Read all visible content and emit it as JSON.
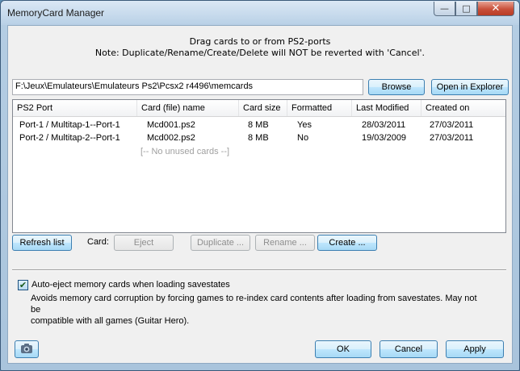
{
  "window": {
    "title": "MemoryCard Manager"
  },
  "notes": {
    "line1": "Drag cards to or from PS2-ports",
    "line2": "Note: Duplicate/Rename/Create/Delete will NOT be reverted with 'Cancel'."
  },
  "path": {
    "value": "F:\\Jeux\\Emulateurs\\Emulateurs Ps2\\Pcsx2 r4496\\memcards",
    "browse_label": "Browse",
    "open_explorer_label": "Open in Explorer"
  },
  "table": {
    "columns": [
      "PS2 Port",
      "Card (file) name",
      "Card size",
      "Formatted",
      "Last Modified",
      "Created on"
    ],
    "rows": [
      {
        "port": "Port-1 / Multitap-1--Port-1",
        "name": "Mcd001.ps2",
        "size": "8 MB",
        "formatted": "Yes",
        "modified": "28/03/2011",
        "created": "27/03/2011"
      },
      {
        "port": "Port-2 / Multitap-2--Port-1",
        "name": "Mcd002.ps2",
        "size": "8 MB",
        "formatted": "No",
        "modified": "19/03/2009",
        "created": "27/03/2011"
      }
    ],
    "unused_placeholder": "[-- No unused cards --]"
  },
  "actions": {
    "refresh_label": "Refresh list",
    "card_label": "Card:",
    "eject_label": "Eject",
    "duplicate_label": "Duplicate ...",
    "rename_label": "Rename ...",
    "create_label": "Create ..."
  },
  "auto_eject": {
    "label": "Auto-eject memory cards when loading savestates",
    "checked": true,
    "description_line1": "Avoids memory card corruption by forcing games to re-index card contents after loading from savestates.  May not be",
    "description_line2": "compatible with all games (Guitar Hero)."
  },
  "footer": {
    "ok_label": "OK",
    "cancel_label": "Cancel",
    "apply_label": "Apply"
  },
  "icons": {
    "camera": "camera-icon",
    "check": "checkmark-icon"
  }
}
